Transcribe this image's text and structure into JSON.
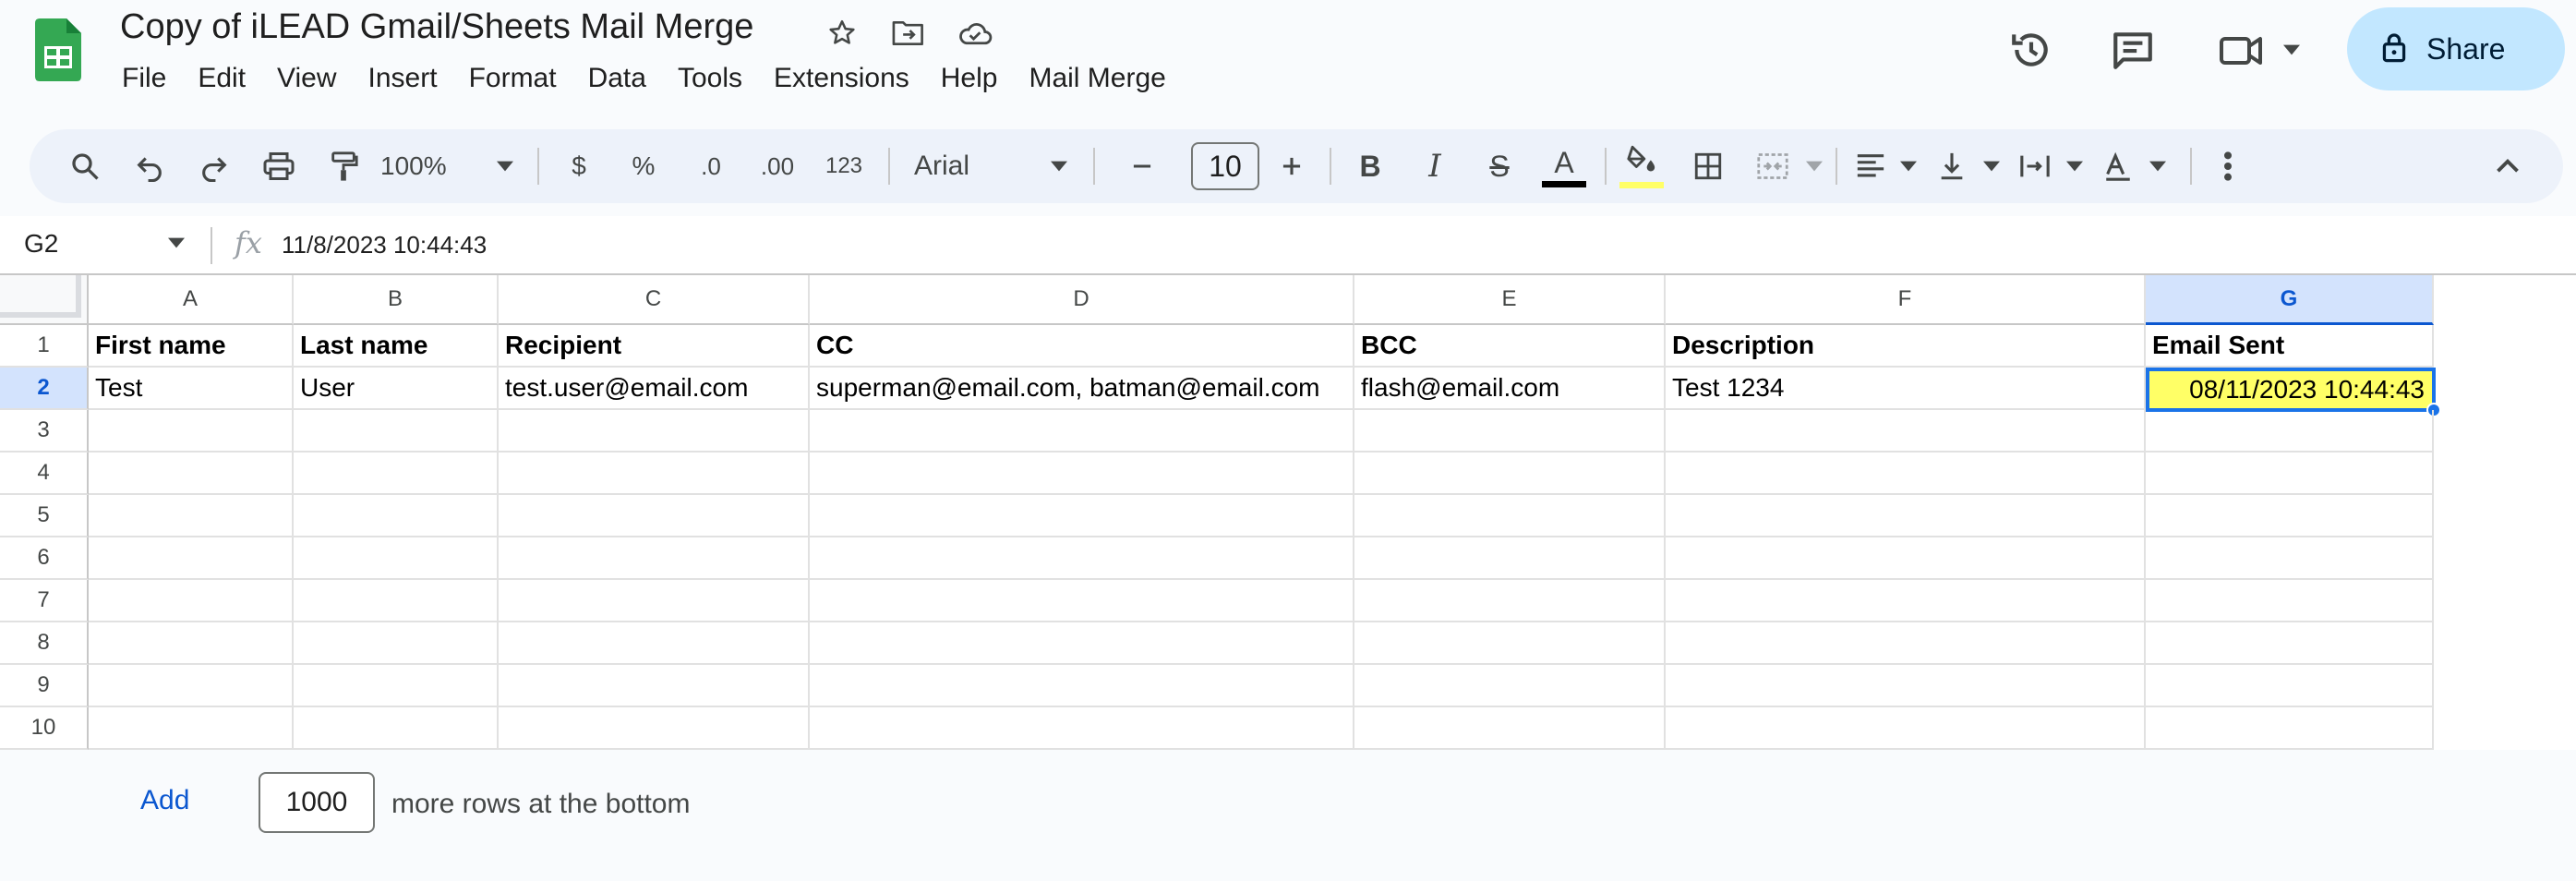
{
  "document": {
    "title": "Copy of iLEAD Gmail/Sheets Mail Merge"
  },
  "menu": [
    "File",
    "Edit",
    "View",
    "Insert",
    "Format",
    "Data",
    "Tools",
    "Extensions",
    "Help",
    "Mail Merge"
  ],
  "share": {
    "label": "Share"
  },
  "toolbar": {
    "zoom": "100%",
    "currency": "$",
    "percent": "%",
    "decrease_decimal": ".0",
    "increase_decimal": ".00",
    "number_format": "123",
    "font": "Arial",
    "font_size": "10",
    "bold": "B",
    "italic": "I",
    "strikethrough": "S",
    "text_color_glyph": "A",
    "text_color": "#000000",
    "fill_color": "#ffff66"
  },
  "formula_bar": {
    "cell_ref": "G2",
    "fx": "fx",
    "value": "11/8/2023 10:44:43"
  },
  "grid": {
    "columns": [
      "A",
      "B",
      "C",
      "D",
      "E",
      "F",
      "G"
    ],
    "selected_column": "G",
    "rows": [
      "1",
      "2",
      "3",
      "4",
      "5",
      "6",
      "7",
      "8",
      "9",
      "10"
    ],
    "selected_row": "2",
    "headers": [
      "First name",
      "Last name",
      "Recipient",
      "CC",
      "BCC",
      "Description",
      "Email Sent"
    ],
    "data": [
      [
        "Test",
        "User",
        "test.user@email.com",
        "superman@email.com, batman@email.com",
        "flash@email.com",
        "Test 1234",
        "08/11/2023 10:44:43"
      ]
    ],
    "highlight_color": "#ffff66"
  },
  "add_rows": {
    "button": "Add",
    "count": "1000",
    "suffix": "more rows at the bottom"
  }
}
